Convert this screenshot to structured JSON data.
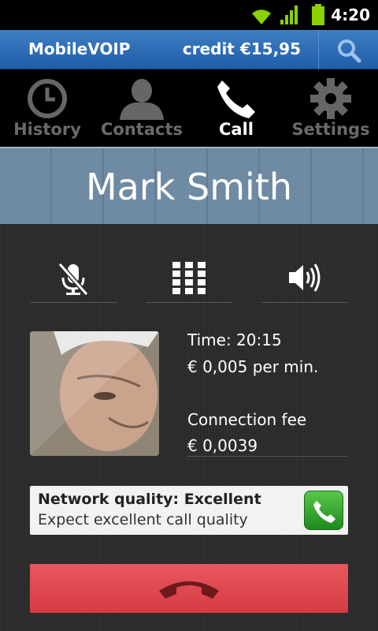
{
  "status_bar": {
    "time": "4:20",
    "icons": [
      "wifi-icon",
      "signal-icon",
      "battery-icon"
    ]
  },
  "app_bar": {
    "title": "MobileVOIP",
    "credit": "credit €15,95",
    "search_icon": "search-icon"
  },
  "tabs": [
    {
      "label": "History",
      "icon": "clock-icon",
      "active": false
    },
    {
      "label": "Contacts",
      "icon": "person-icon",
      "active": false
    },
    {
      "label": "Call",
      "icon": "phone-icon",
      "active": true
    },
    {
      "label": "Settings",
      "icon": "gear-icon",
      "active": false
    }
  ],
  "call": {
    "contact_name": "Mark Smith",
    "controls": [
      {
        "name": "mute",
        "icon": "mic-off-icon"
      },
      {
        "name": "keypad",
        "icon": "keypad-icon"
      },
      {
        "name": "speaker",
        "icon": "speaker-icon"
      }
    ],
    "time": "Time: 20:15",
    "rate": "€ 0,005 per min.",
    "connection_fee_label": "Connection fee",
    "connection_fee_value": "€ 0,0039"
  },
  "network_quality": {
    "title": "Network quality: Excellent",
    "subtitle": "Expect excellent call quality",
    "icon": "phone-icon"
  },
  "hangup": {
    "icon": "hang-up-icon"
  },
  "colors": {
    "header_blue": "#2a6ab4",
    "hangup_red": "#dc434a",
    "quality_green": "#3aa93a"
  }
}
